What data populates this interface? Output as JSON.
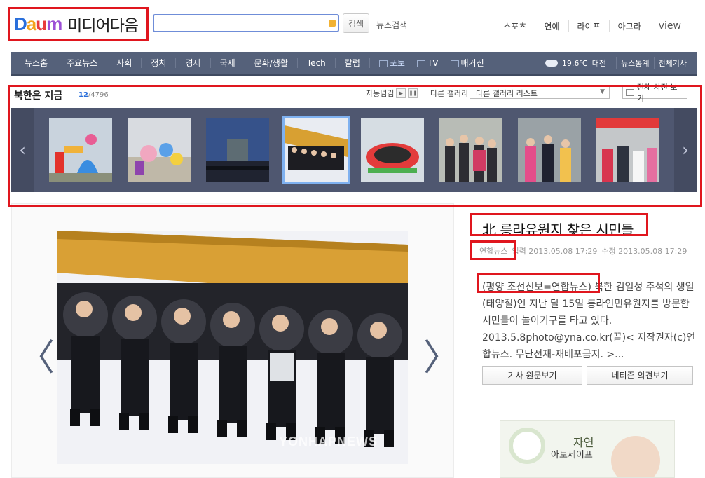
{
  "header": {
    "logo_letters": [
      "D",
      "a",
      "u",
      "m"
    ],
    "logo_service": "미디어다음",
    "search_button": "검색",
    "news_search": "뉴스검색",
    "top_links": [
      "스포츠",
      "연예",
      "라이프",
      "아고라",
      "view"
    ]
  },
  "nav": {
    "items": [
      "뉴스홈",
      "주요뉴스",
      "사회",
      "정치",
      "경제",
      "국제",
      "문화/생활",
      "Tech",
      "칼럼",
      "포토",
      "TV",
      "매거진"
    ],
    "weather_temp": "19.6℃",
    "weather_city": "대전",
    "right_links": [
      "뉴스통계",
      "전체기사"
    ]
  },
  "gallery": {
    "title": "북한은 지금",
    "current": "12",
    "total": "/4796",
    "autoplay_label": "자동넘김",
    "other_gallery_label": "다른 갤러리",
    "select_value": "다른 갤러리 리스트",
    "all_photos": "전체 사진 보기",
    "prev_icon": "‹",
    "next_icon": "›",
    "selected_index": 3
  },
  "viewer": {
    "prev_icon": "〈",
    "next_icon": "〉",
    "watermark": "YONHAPNEWS"
  },
  "article": {
    "title": "北 릉라유원지 찾은 시민들",
    "source": "연합뉴스",
    "input_time": "입력 2013.05.08 17:29",
    "edit_time": "수정 2013.05.08 17:29",
    "body_lead": "(평양 조선신보=연합뉴스)",
    "body_rest": " 북한 김일성 주석의 생일(태양절)인 지난 달 15일 릉라인민유원지를 방문한 시민들이 놀이기구를 타고 있다. 2013.5.8photo@yna.co.kr(끝)< 저작권자(c)연합뉴스. 무단전재-재배포금지. >...",
    "btn_original": "기사 원문보기",
    "btn_comments": "네티즌 의견보기"
  },
  "ad": {
    "line1": "자연",
    "line2": "아토세이프"
  }
}
